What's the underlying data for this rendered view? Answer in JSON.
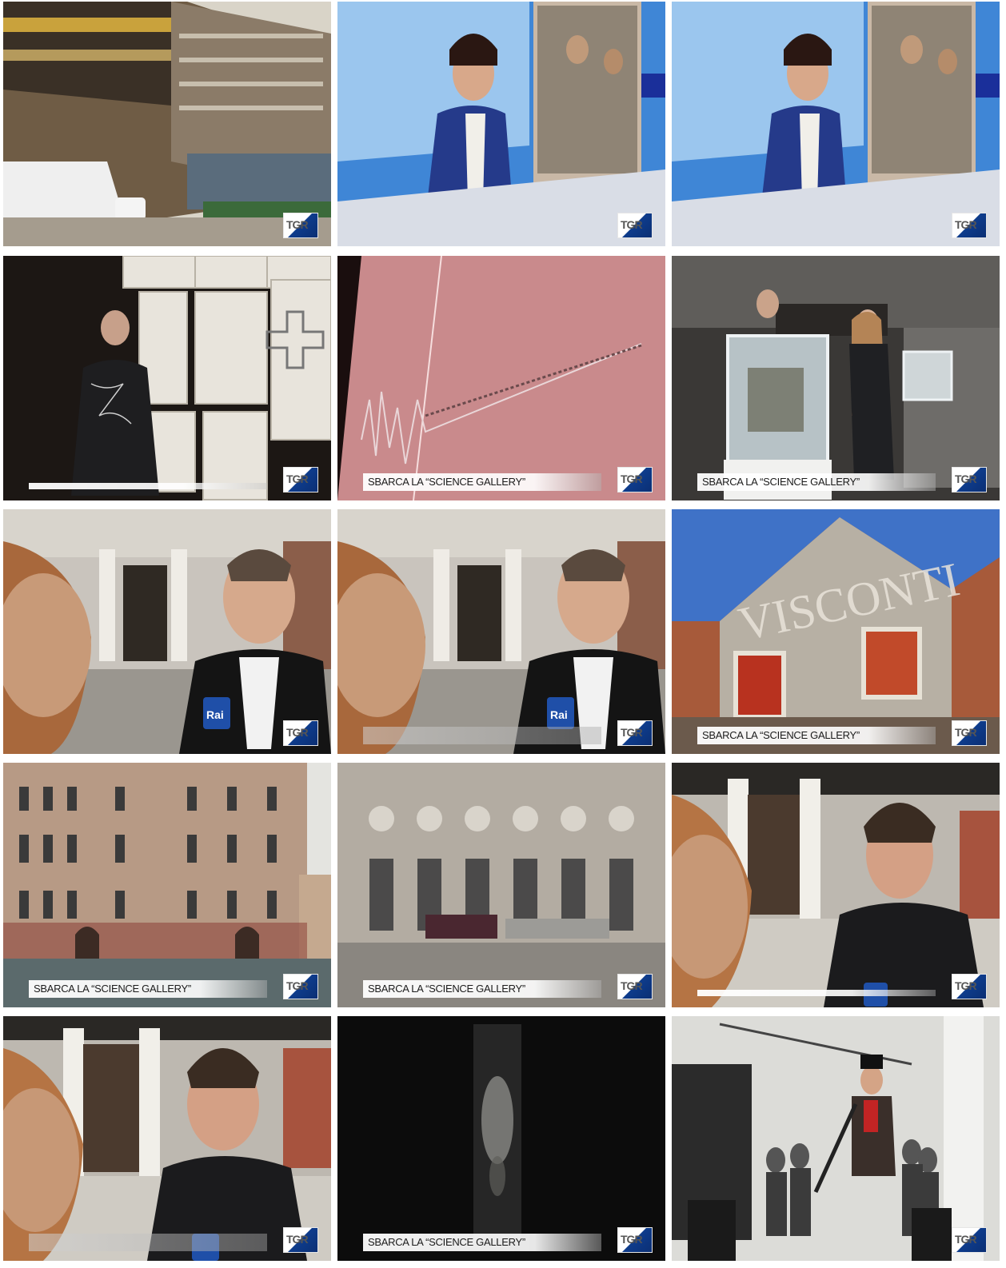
{
  "logo_text": "TGR",
  "caption_text": "SBARCA LA “SCIENCE GALLERY”",
  "mic_label": "Rai",
  "frames": [
    {
      "caption": ""
    },
    {
      "caption": ""
    },
    {
      "caption": ""
    },
    {
      "caption": ""
    },
    {
      "caption": "SBARCA LA “SCIENCE GALLERY”"
    },
    {
      "caption": "SBARCA LA “SCIENCE GALLERY”"
    },
    {
      "caption": ""
    },
    {
      "caption": ""
    },
    {
      "caption": "SBARCA LA “SCIENCE GALLERY”"
    },
    {
      "caption": "SBARCA LA “SCIENCE GALLERY”"
    },
    {
      "caption": "SBARCA LA “SCIENCE GALLERY”"
    },
    {
      "caption": ""
    },
    {
      "caption": ""
    },
    {
      "caption": "SBARCA LA “SCIENCE GALLERY”"
    },
    {
      "caption": ""
    }
  ]
}
